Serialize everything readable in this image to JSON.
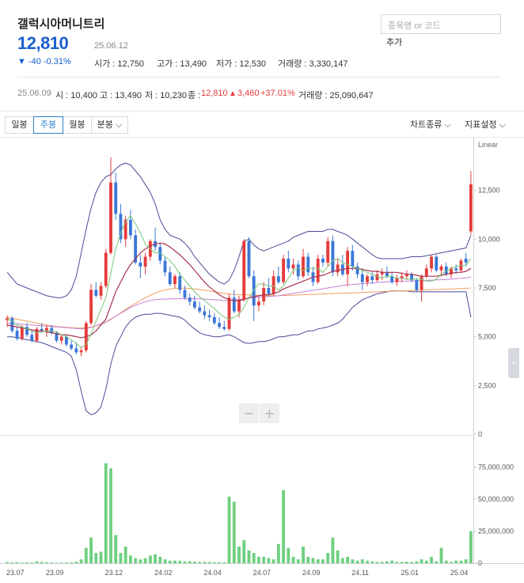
{
  "stock": {
    "name": "갤럭시아머니트리",
    "price": "12,810",
    "date": "25.06.12",
    "change": "▼ -40 -0.31%",
    "open_label": "시가 : 12,750",
    "high_label": "고가 : 13,490",
    "low_label": "저가 : 12,530",
    "volume_label": "거래량 : 3,330,147"
  },
  "search": {
    "placeholder": "종목명 or 코드",
    "add_label": "추가"
  },
  "weekly": {
    "date": "25.06.09",
    "open": "시 : 10,400",
    "high": "고 : 13,490",
    "low": "저 : 10,230",
    "close_label": "종 :",
    "close_value": "12,810",
    "change_tri": "▲",
    "change": "3,460",
    "pct": "+37.01%",
    "volume": "거래량 : 25,090,647"
  },
  "toolbar": {
    "daily": "일봉",
    "weekly": "주봉",
    "monthly": "월봉",
    "minute": "분봉",
    "minute_arrow": "⌵",
    "chart_type": "차트종류",
    "chart_type_arrow": "⌵",
    "indicator": "지표설정",
    "indicator_arrow": "⌵"
  },
  "colors": {
    "up": "#e53b3b",
    "down": "#3a77d8",
    "volume": "#6fd080",
    "ma5": "#77c777",
    "ma20": "#a8324f",
    "ma60": "#c77ed8",
    "ma120": "#f0a060",
    "band": "#4b4b98",
    "price_blue": "#1a5fd1"
  },
  "chart_data": {
    "type": "candlestick",
    "price_axis": {
      "label": "Linear",
      "ticks": [
        "12,500",
        "10,000",
        "7,500",
        "5,000",
        "2,500",
        "0"
      ],
      "ylim": [
        0,
        15000
      ]
    },
    "volume_axis": {
      "ticks": [
        "75,000,000",
        "50,000,000",
        "25,000,000",
        "0"
      ],
      "ylim": [
        0,
        100000000
      ]
    },
    "x_ticks": [
      "23.07",
      "23.09",
      "23.12",
      "24.02",
      "24.04",
      "24.07",
      "24.09",
      "24.11",
      "25.01",
      "25.04"
    ],
    "zoom_controls": [
      "−",
      "+"
    ],
    "candles_ohlc": [
      [
        5850,
        6100,
        5500,
        5950
      ],
      [
        5950,
        6050,
        5200,
        5300
      ],
      [
        5300,
        5500,
        4800,
        4900
      ],
      [
        4900,
        5600,
        4800,
        5500
      ],
      [
        5500,
        5700,
        5000,
        5100
      ],
      [
        5100,
        5300,
        4700,
        4800
      ],
      [
        4800,
        5500,
        4700,
        5400
      ],
      [
        5400,
        5700,
        5200,
        5300
      ],
      [
        5300,
        5600,
        5000,
        5450
      ],
      [
        5450,
        5600,
        5100,
        5200
      ],
      [
        5200,
        5300,
        4700,
        4800
      ],
      [
        4800,
        5100,
        4600,
        5000
      ],
      [
        5000,
        5100,
        4500,
        4600
      ],
      [
        4600,
        4800,
        4300,
        4400
      ],
      [
        4400,
        4700,
        4100,
        4200
      ],
      [
        4200,
        4500,
        4000,
        4300
      ],
      [
        4300,
        5800,
        4200,
        5700
      ],
      [
        5700,
        7700,
        5600,
        7400
      ],
      [
        7400,
        7800,
        7000,
        7100
      ],
      [
        7100,
        7800,
        6900,
        7600
      ],
      [
        7600,
        9500,
        7500,
        9300
      ],
      [
        9300,
        14200,
        9200,
        12900
      ],
      [
        12900,
        13400,
        11000,
        11300
      ],
      [
        11300,
        11800,
        9800,
        10000
      ],
      [
        10000,
        11200,
        9600,
        11000
      ],
      [
        11000,
        11500,
        10000,
        10200
      ],
      [
        10200,
        10500,
        8700,
        8800
      ],
      [
        8800,
        9200,
        8000,
        8600
      ],
      [
        8600,
        9300,
        8200,
        9100
      ],
      [
        9100,
        10000,
        8900,
        9900
      ],
      [
        9900,
        10600,
        9400,
        9600
      ],
      [
        9600,
        9800,
        8700,
        8900
      ],
      [
        8900,
        9100,
        8100,
        8300
      ],
      [
        8300,
        8600,
        7600,
        7700
      ],
      [
        7700,
        8200,
        7500,
        8100
      ],
      [
        8100,
        8300,
        7200,
        7400
      ],
      [
        7400,
        7600,
        6900,
        7000
      ],
      [
        7000,
        7200,
        6600,
        6800
      ],
      [
        6800,
        7100,
        6400,
        6500
      ],
      [
        6500,
        6800,
        6200,
        6300
      ],
      [
        6300,
        6600,
        5900,
        6100
      ],
      [
        6100,
        6400,
        5800,
        6000
      ],
      [
        6000,
        6200,
        5600,
        5700
      ],
      [
        5700,
        6000,
        5400,
        5500
      ],
      [
        5500,
        5800,
        5300,
        5400
      ],
      [
        5400,
        7200,
        5300,
        7000
      ],
      [
        7000,
        7400,
        6200,
        6300
      ],
      [
        6300,
        7100,
        6000,
        6900
      ],
      [
        6900,
        10000,
        6800,
        9900
      ],
      [
        9900,
        10100,
        8000,
        8100
      ],
      [
        8100,
        8400,
        5800,
        6600
      ],
      [
        6600,
        7000,
        6300,
        6800
      ],
      [
        6800,
        7800,
        6600,
        7500
      ],
      [
        7500,
        8000,
        7100,
        7200
      ],
      [
        7200,
        8400,
        7100,
        8100
      ],
      [
        8100,
        8600,
        7700,
        7800
      ],
      [
        7800,
        9200,
        7700,
        9000
      ],
      [
        9000,
        9400,
        8300,
        8500
      ],
      [
        8500,
        9000,
        8200,
        8700
      ],
      [
        8700,
        8900,
        7900,
        8100
      ],
      [
        8100,
        9500,
        8000,
        9100
      ],
      [
        9100,
        9300,
        8100,
        8300
      ],
      [
        8300,
        8600,
        7600,
        7800
      ],
      [
        7800,
        9200,
        7700,
        9000
      ],
      [
        9000,
        9200,
        8600,
        8800
      ],
      [
        8800,
        10100,
        8600,
        9900
      ],
      [
        9900,
        10200,
        8100,
        8300
      ],
      [
        8300,
        9000,
        8100,
        8700
      ],
      [
        8700,
        9200,
        8100,
        8200
      ],
      [
        8200,
        9600,
        7600,
        9400
      ],
      [
        9400,
        9700,
        8400,
        8600
      ],
      [
        8600,
        8800,
        8000,
        8200
      ],
      [
        8200,
        8500,
        7400,
        7800
      ],
      [
        7800,
        8200,
        7600,
        8100
      ],
      [
        8100,
        8300,
        7700,
        7900
      ],
      [
        7900,
        8400,
        7800,
        8200
      ],
      [
        8200,
        8500,
        7900,
        8300
      ],
      [
        8300,
        8600,
        8000,
        8100
      ],
      [
        8100,
        8300,
        7700,
        7800
      ],
      [
        7800,
        8200,
        7600,
        8000
      ],
      [
        8000,
        8300,
        7800,
        8100
      ],
      [
        8100,
        8400,
        7900,
        8200
      ],
      [
        8200,
        8300,
        7800,
        7900
      ],
      [
        7900,
        8000,
        7300,
        7400
      ],
      [
        7400,
        8200,
        6800,
        8100
      ],
      [
        8100,
        8700,
        8000,
        8500
      ],
      [
        8500,
        9200,
        8300,
        9100
      ],
      [
        9100,
        9200,
        8300,
        8400
      ],
      [
        8400,
        8700,
        8100,
        8600
      ],
      [
        8600,
        8800,
        8100,
        8200
      ],
      [
        8200,
        8600,
        8000,
        8500
      ],
      [
        8500,
        8700,
        8200,
        8400
      ],
      [
        8400,
        9000,
        8300,
        8900
      ],
      [
        9000,
        9300,
        8600,
        8800
      ],
      [
        10400,
        13490,
        10230,
        12810
      ]
    ],
    "volume": [
      1,
      0.6,
      0.8,
      0.5,
      0.6,
      0.5,
      1.5,
      1,
      0.8,
      0.6,
      0.5,
      0.4,
      0.5,
      0.6,
      1.2,
      3,
      12,
      20,
      8,
      9,
      78,
      74,
      22,
      8,
      13,
      6,
      4,
      3,
      4,
      6,
      7,
      5,
      3,
      2,
      2,
      2,
      1.5,
      1.5,
      1.2,
      1,
      1,
      1,
      0.8,
      0.8,
      0.8,
      52,
      48,
      13,
      18,
      10,
      8,
      5,
      5,
      4,
      3,
      15,
      57,
      12,
      5,
      3,
      13,
      5,
      4,
      3,
      3,
      8,
      20,
      10,
      4,
      5,
      3,
      2,
      3,
      2,
      1.5,
      1,
      1,
      1.5,
      2,
      1,
      1,
      1.2,
      1,
      1.5,
      3,
      2,
      5,
      1.5,
      12,
      2,
      1,
      2,
      2,
      3,
      25
    ],
    "band_upper": [
      8300,
      8000,
      7700,
      7600,
      7500,
      7400,
      7300,
      7200,
      7100,
      7050,
      7000,
      7000,
      7100,
      7400,
      8100,
      9300,
      10500,
      11600,
      12400,
      12900,
      13200,
      13300,
      13600,
      13800,
      13900,
      13800,
      13500,
      13200,
      12800,
      12400,
      11800,
      11000,
      10500,
      10200,
      10100,
      10000,
      9800,
      9500,
      9100,
      8800,
      8500,
      8200,
      8000,
      7800,
      7700,
      7900,
      8400,
      9100,
      9900,
      10000,
      9700,
      9500,
      9400,
      9500,
      9600,
      9700,
      9800,
      9900,
      10100,
      10200,
      10300,
      10400,
      10400,
      10400,
      10400,
      10500,
      10500,
      10400,
      10300,
      10200,
      10000,
      9800,
      9600,
      9400,
      9200,
      9050,
      9000,
      9000,
      9000,
      9000,
      9000,
      9050,
      9100,
      9100,
      9100,
      9150,
      9200,
      9250,
      9300,
      9350,
      9400,
      9450,
      9500,
      9550,
      10200
    ],
    "band_lower": [
      5000,
      5000,
      4950,
      4900,
      4850,
      4800,
      4750,
      4700,
      4600,
      4500,
      4400,
      4300,
      4200,
      4000,
      3300,
      2200,
      1200,
      1000,
      1100,
      1400,
      2300,
      3600,
      4500,
      5000,
      5500,
      5800,
      6000,
      6100,
      6150,
      6150,
      6200,
      6200,
      6150,
      6100,
      6050,
      6000,
      5850,
      5600,
      5400,
      5200,
      5100,
      5050,
      5000,
      5000,
      5050,
      5100,
      5000,
      4850,
      4700,
      4650,
      4700,
      4750,
      4750,
      4800,
      4900,
      5000,
      5000,
      5050,
      5100,
      5100,
      5200,
      5300,
      5300,
      5400,
      5450,
      5500,
      5600,
      5700,
      5900,
      6200,
      6500,
      6700,
      6900,
      7000,
      7100,
      7200,
      7250,
      7300,
      7350,
      7350,
      7350,
      7350,
      7300,
      7300,
      7300,
      7300,
      7300,
      7300,
      7300,
      7300,
      7300,
      7300,
      7300,
      7300,
      6000
    ],
    "ma_short": [
      5900,
      5800,
      5600,
      5500,
      5400,
      5300,
      5200,
      5250,
      5300,
      5300,
      5250,
      5100,
      5000,
      4850,
      4650,
      4450,
      4600,
      5150,
      5800,
      6400,
      7000,
      8250,
      9500,
      10300,
      10900,
      11200,
      10800,
      10300,
      9750,
      9500,
      9300,
      9300,
      9100,
      8900,
      8600,
      8200,
      7900,
      7600,
      7300,
      7050,
      6850,
      6650,
      6450,
      6200,
      6000,
      5900,
      6000,
      6150,
      6500,
      7000,
      7400,
      7700,
      7700,
      7600,
      7600,
      7400,
      7600,
      8000,
      8400,
      8500,
      8400,
      8500,
      8500,
      8500,
      8300,
      8600,
      8900,
      9000,
      8800,
      8700,
      8600,
      8500,
      8400,
      8300,
      8200,
      8100,
      8000,
      8100,
      8100,
      8000,
      8000,
      7950,
      7950,
      7950,
      7950,
      7850,
      7850,
      7950,
      8200,
      8350,
      8500,
      8600,
      8650,
      8650,
      9000
    ],
    "ma_mid": [
      5600,
      5550,
      5500,
      5450,
      5400,
      5350,
      5300,
      5300,
      5250,
      5200,
      5150,
      5100,
      5100,
      5050,
      5000,
      4950,
      5000,
      5100,
      5300,
      5600,
      5900,
      6600,
      7300,
      7800,
      8300,
      8700,
      9000,
      9300,
      9500,
      9650,
      9750,
      9800,
      9750,
      9600,
      9400,
      9200,
      8950,
      8700,
      8400,
      8100,
      7800,
      7550,
      7350,
      7150,
      7000,
      6900,
      6850,
      6850,
      6900,
      7000,
      7050,
      7100,
      7150,
      7150,
      7200,
      7300,
      7450,
      7550,
      7650,
      7750,
      7850,
      7950,
      8050,
      8100,
      8150,
      8250,
      8350,
      8400,
      8450,
      8500,
      8500,
      8500,
      8450,
      8400,
      8350,
      8350,
      8300,
      8300,
      8300,
      8300,
      8250,
      8200,
      8200,
      8150,
      8100,
      8100,
      8100,
      8100,
      8150,
      8200,
      8250,
      8300,
      8300,
      8350,
      8500
    ],
    "ma_long": [
      5700,
      5680,
      5660,
      5640,
      5620,
      5600,
      5580,
      5560,
      5540,
      5520,
      5500,
      5480,
      5460,
      5440,
      5420,
      5400,
      5420,
      5480,
      5560,
      5660,
      5760,
      5900,
      6050,
      6200,
      6350,
      6500,
      6600,
      6700,
      6800,
      6850,
      6900,
      6920,
      6930,
      6940,
      6950,
      6950,
      6950,
      6950,
      6950,
      6940,
      6930,
      6910,
      6890,
      6870,
      6850,
      6850,
      6870,
      6900,
      6940,
      6980,
      7000,
      7020,
      7040,
      7060,
      7080,
      7100,
      7140,
      7180,
      7220,
      7260,
      7300,
      7340,
      7380,
      7420,
      7460,
      7500,
      7540,
      7580,
      7620,
      7660,
      7680,
      7700,
      7720,
      7740,
      7760,
      7780,
      7800,
      7810,
      7820,
      7830,
      7840,
      7850,
      7860,
      7870,
      7880,
      7890,
      7900,
      7910,
      7920,
      7930,
      7950,
      7980,
      8000,
      8020,
      8050
    ],
    "ma_longest": [
      6000,
      5950,
      5900,
      5850,
      5800,
      5750,
      5700,
      5650,
      5600,
      5560,
      5520,
      5500,
      5480,
      5460,
      5450,
      5440,
      5460,
      5500,
      5560,
      5640,
      5740,
      5880,
      6050,
      6220,
      6400,
      6560,
      6700,
      6850,
      7000,
      7120,
      7240,
      7330,
      7400,
      7450,
      7480,
      7490,
      7490,
      7470,
      7450,
      7420,
      7380,
      7340,
      7300,
      7260,
      7220,
      7190,
      7170,
      7160,
      7150,
      7140,
      7130,
      7120,
      7110,
      7100,
      7100,
      7100,
      7110,
      7120,
      7130,
      7140,
      7150,
      7160,
      7170,
      7180,
      7190,
      7200,
      7210,
      7220,
      7230,
      7240,
      7250,
      7260,
      7270,
      7280,
      7290,
      7300,
      7310,
      7320,
      7330,
      7340,
      7350,
      7360,
      7370,
      7380,
      7390,
      7400,
      7410,
      7420,
      7430,
      7440,
      7450,
      7460,
      7470,
      7480,
      7500
    ]
  }
}
